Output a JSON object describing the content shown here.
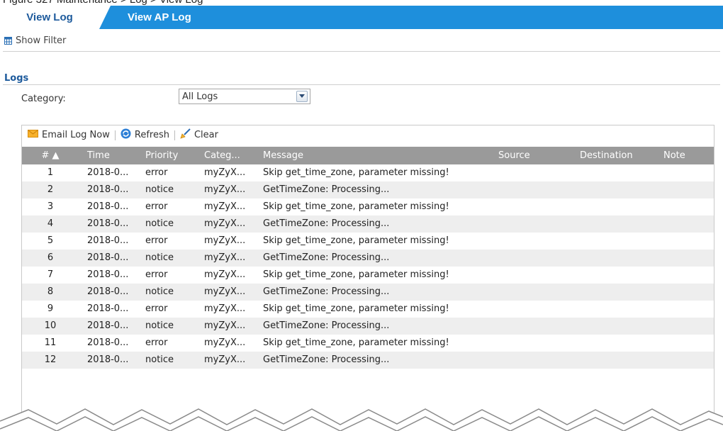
{
  "caption": "Figure 327   Maintenance > Log > View Log",
  "tabs": [
    {
      "label": "View Log",
      "active": true
    },
    {
      "label": "View AP Log",
      "active": false
    }
  ],
  "filter": {
    "label": "Show Filter",
    "icon": "table-icon"
  },
  "section": {
    "title": "Logs"
  },
  "category": {
    "label": "Category:",
    "value": "All Logs"
  },
  "toolbar": {
    "email_label": "Email Log Now",
    "refresh_label": "Refresh",
    "clear_label": "Clear"
  },
  "table": {
    "columns": {
      "num": "# ▲",
      "time": "Time",
      "priority": "Priority",
      "category": "Categ...",
      "message": "Message",
      "source": "Source",
      "destination": "Destination",
      "note": "Note"
    },
    "rows": [
      {
        "num": "1",
        "time": "2018-0...",
        "priority": "error",
        "category": "myZyX...",
        "message": "Skip get_time_zone, parameter missing!"
      },
      {
        "num": "2",
        "time": "2018-0...",
        "priority": "notice",
        "category": "myZyX...",
        "message": "GetTimeZone: Processing..."
      },
      {
        "num": "3",
        "time": "2018-0...",
        "priority": "error",
        "category": "myZyX...",
        "message": "Skip get_time_zone, parameter missing!"
      },
      {
        "num": "4",
        "time": "2018-0...",
        "priority": "notice",
        "category": "myZyX...",
        "message": "GetTimeZone: Processing..."
      },
      {
        "num": "5",
        "time": "2018-0...",
        "priority": "error",
        "category": "myZyX...",
        "message": "Skip get_time_zone, parameter missing!"
      },
      {
        "num": "6",
        "time": "2018-0...",
        "priority": "notice",
        "category": "myZyX...",
        "message": "GetTimeZone: Processing..."
      },
      {
        "num": "7",
        "time": "2018-0...",
        "priority": "error",
        "category": "myZyX...",
        "message": "Skip get_time_zone, parameter missing!"
      },
      {
        "num": "8",
        "time": "2018-0...",
        "priority": "notice",
        "category": "myZyX...",
        "message": "GetTimeZone: Processing..."
      },
      {
        "num": "9",
        "time": "2018-0...",
        "priority": "error",
        "category": "myZyX...",
        "message": "Skip get_time_zone, parameter missing!"
      },
      {
        "num": "10",
        "time": "2018-0...",
        "priority": "notice",
        "category": "myZyX...",
        "message": "GetTimeZone: Processing..."
      },
      {
        "num": "11",
        "time": "2018-0...",
        "priority": "error",
        "category": "myZyX...",
        "message": "Skip get_time_zone, parameter missing!"
      },
      {
        "num": "12",
        "time": "2018-0...",
        "priority": "notice",
        "category": "myZyX...",
        "message": "GetTimeZone: Processing..."
      }
    ]
  },
  "colors": {
    "tab_bar": "#1e8fdc",
    "active_tab_text": "#1d5a9c",
    "header_bg": "#9a9a9a",
    "alt_row": "#eeeeee"
  }
}
